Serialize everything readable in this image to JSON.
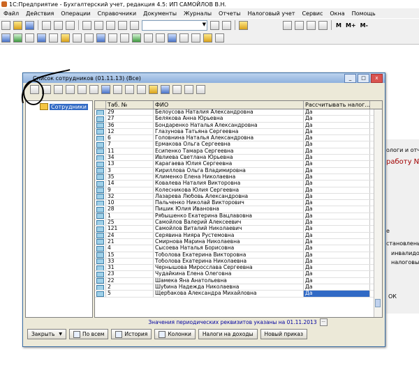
{
  "app": {
    "title": "1С:Предприятие - Бухгалтерский учет, редакция 4.5: ИП САМОЙЛОВ В.Н."
  },
  "menu": [
    "Файл",
    "Действия",
    "Операции",
    "Справочники",
    "Документы",
    "Журналы",
    "Отчеты",
    "Налоговый учет",
    "Сервис",
    "Окна",
    "Помощь"
  ],
  "toolbar": {
    "m_labels": [
      "M",
      "M+",
      "M-"
    ]
  },
  "background": {
    "texts": [
      "ологи и отчисл",
      "работу №",
      "е",
      "становлены",
      "инвалидом",
      "налоговым ре",
      "ОК"
    ]
  },
  "window": {
    "title": "Список сотрудников (01.11.13) (Все)",
    "tree_root": "Сотрудники",
    "columns": [
      "Таб. №",
      "ФИО",
      "Рассчитывать налог..."
    ],
    "rows": [
      {
        "tab": "29",
        "name": "Белоусова Наталия Александровна",
        "calc": "Да"
      },
      {
        "tab": "27",
        "name": "Белякова Анна Юрьевна",
        "calc": "Да"
      },
      {
        "tab": "36",
        "name": "Бондаренко  Наталья Александровна",
        "calc": "Да"
      },
      {
        "tab": "12",
        "name": "Глазунова Татьяна Сергеевна",
        "calc": "Да"
      },
      {
        "tab": "6",
        "name": "Головнина Наталья Александровна",
        "calc": "Да"
      },
      {
        "tab": "7",
        "name": "Ермакова Ольга Сергеевна",
        "calc": "Да"
      },
      {
        "tab": "11",
        "name": "Есипенко Тамара Сергеевна",
        "calc": "Да"
      },
      {
        "tab": "34",
        "name": "Ивлиева Светлана Юрьевна",
        "calc": "Да"
      },
      {
        "tab": "13",
        "name": "Карагаева Юлия Сергеевна",
        "calc": "Да"
      },
      {
        "tab": "3",
        "name": "Кириллова Ольга Владимировна",
        "calc": "Да"
      },
      {
        "tab": "35",
        "name": "Клименко Елена Николаевна",
        "calc": "Да"
      },
      {
        "tab": "14",
        "name": "Ковалева Наталия Викторовна",
        "calc": "Да"
      },
      {
        "tab": "9",
        "name": "Колесникова Юлия Сергеевна",
        "calc": "Да"
      },
      {
        "tab": "32",
        "name": "Лазарева Любовь Александровна",
        "calc": "Да"
      },
      {
        "tab": "10",
        "name": "Пальченко Николай Викторович",
        "calc": "Да"
      },
      {
        "tab": "28",
        "name": "Пишик Юлия Ивановна",
        "calc": "Да"
      },
      {
        "tab": "1",
        "name": "Рябышенко Екатерина Вацлавовна",
        "calc": "Да"
      },
      {
        "tab": "25",
        "name": "Самойлов Валерий Алексеевич",
        "calc": "Да"
      },
      {
        "tab": "121",
        "name": "Самойлов Виталий Николаевич",
        "calc": "Да"
      },
      {
        "tab": "24",
        "name": "Серявина Нияра Рустемовна",
        "calc": "Да"
      },
      {
        "tab": "21",
        "name": "Смирнова Марина Николаевна",
        "calc": "Да"
      },
      {
        "tab": "4",
        "name": "Сысоева Наталья Борисовна",
        "calc": "Да"
      },
      {
        "tab": "15",
        "name": "Тоболова Екатерина Викторовна",
        "calc": "Да"
      },
      {
        "tab": "33",
        "name": "Тоболова Екатерина Николаевна",
        "calc": "Да"
      },
      {
        "tab": "31",
        "name": "Чернышова Миросслава Сергеевна",
        "calc": "Да"
      },
      {
        "tab": "23",
        "name": "Чудайкина Елена Олеговна",
        "calc": "Да"
      },
      {
        "tab": "22",
        "name": "Шамека Яна Анатольевна",
        "calc": "Да"
      },
      {
        "tab": "2",
        "name": "Шубина Надежда Николаевна",
        "calc": "Да"
      },
      {
        "tab": "5",
        "name": "Щербакова Александра Михайловна",
        "calc": "Да"
      }
    ],
    "status": "Значения периодических реквизитов указаны на 01.11.2013",
    "buttons": [
      "Закрыть",
      "По всем",
      "История",
      "Колонки",
      "Налоги на доходы",
      "Новый приказ"
    ]
  }
}
